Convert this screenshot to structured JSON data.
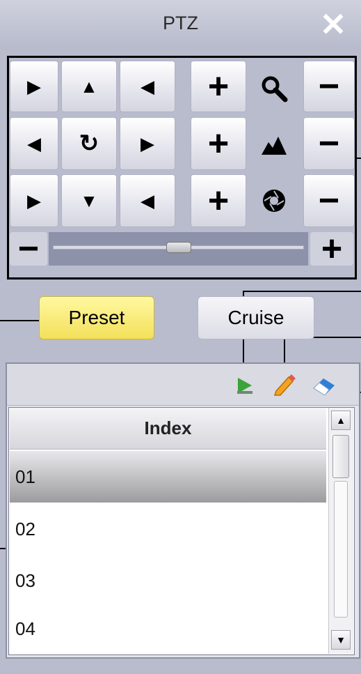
{
  "window": {
    "title": "PTZ",
    "close_glyph": "✕"
  },
  "ptz": {
    "direction_buttons": [
      {
        "name": "up-left-arrow-icon",
        "glyph": "▶"
      },
      {
        "name": "up-arrow-icon",
        "glyph": "▲"
      },
      {
        "name": "up-right-arrow-icon",
        "glyph": "◀"
      },
      {
        "name": "left-arrow-icon",
        "glyph": "◀"
      },
      {
        "name": "auto-rotate-icon",
        "glyph": "↻"
      },
      {
        "name": "right-arrow-icon",
        "glyph": "▶"
      },
      {
        "name": "down-left-arrow-icon",
        "glyph": "▶"
      },
      {
        "name": "down-arrow-icon",
        "glyph": "▼"
      },
      {
        "name": "down-right-arrow-icon",
        "glyph": "◀"
      }
    ],
    "plus_glyph": "+",
    "minus_glyph": "−",
    "row_icons": [
      "zoom-icon",
      "focus-icon",
      "iris-icon"
    ],
    "speed": {
      "minus_glyph": "−",
      "plus_glyph": "+",
      "level": 0.5
    }
  },
  "tabs": {
    "preset": "Preset",
    "cruise": "Cruise"
  },
  "toolbar": {
    "icons": [
      "play-icon",
      "edit-pencil-icon",
      "eraser-icon"
    ]
  },
  "list": {
    "header": "Index",
    "rows": [
      "01",
      "02",
      "03",
      "04"
    ],
    "selected_index": 0
  },
  "colors": {
    "preset_tab": "#f3e05a",
    "background": "#b9bccd",
    "play_green": "#3aa33a"
  }
}
